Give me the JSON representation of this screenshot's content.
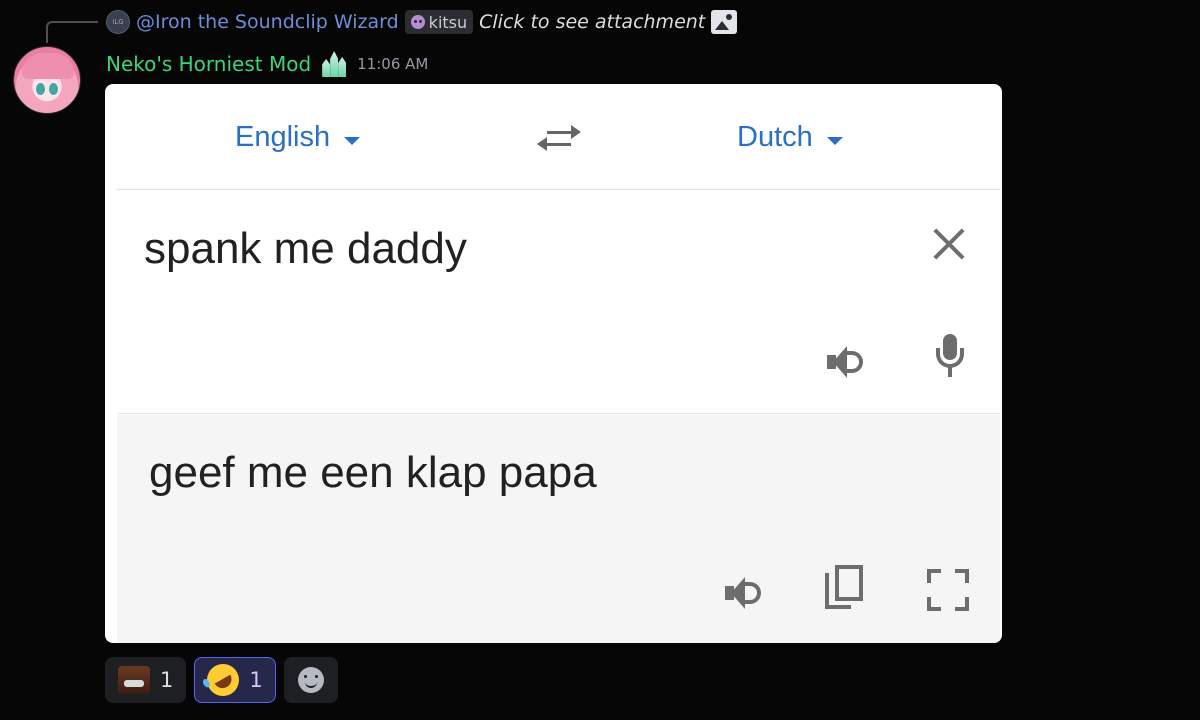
{
  "reply": {
    "avatar_text": "ILG",
    "user": "@Iron the Soundclip Wizard",
    "tag": "kitsu",
    "text": "Click to see attachment"
  },
  "message": {
    "username": "Neko's Horniest Mod",
    "timestamp": "11:06 AM"
  },
  "translator": {
    "source_language": "English",
    "target_language": "Dutch",
    "source_text": "spank me daddy",
    "translated_text": "geef me een klap papa"
  },
  "reactions": [
    {
      "emoji": "face-emoji",
      "count": "1",
      "active": false
    },
    {
      "emoji": "rolling-on-floor-laughing-emoji",
      "count": "1",
      "active": true
    }
  ],
  "colors": {
    "background": "#060607",
    "username": "#3ed37a",
    "reply_user": "#6b8fd8",
    "language_link": "#2b6fc4",
    "reaction_active_border": "#5865f2"
  }
}
